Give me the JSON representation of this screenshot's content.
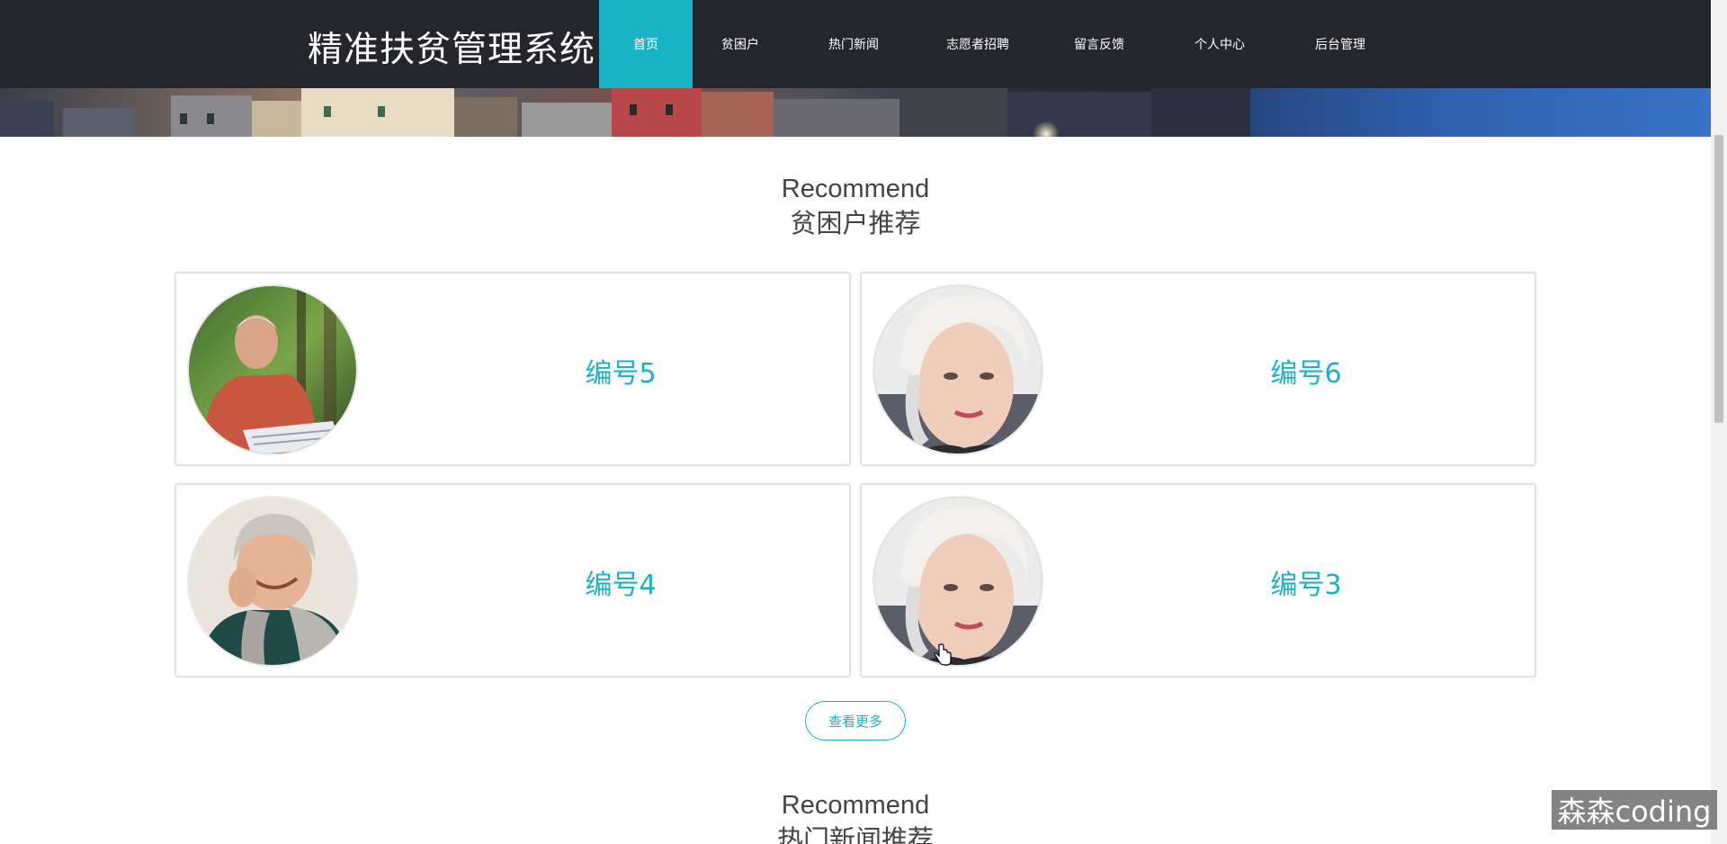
{
  "header": {
    "site_title": "精准扶贫管理系统",
    "nav": [
      {
        "label": "首页",
        "active": true
      },
      {
        "label": "贫困户"
      },
      {
        "label": "热门新闻"
      },
      {
        "label": "志愿者招聘"
      },
      {
        "label": "留言反馈"
      },
      {
        "label": "个人中心"
      },
      {
        "label": "后台管理"
      }
    ]
  },
  "section1": {
    "heading_en": "Recommend",
    "heading_cn": "贫困户推荐",
    "cards": [
      {
        "title": "编号5",
        "avatar": "elderly-man-reading-newspaper"
      },
      {
        "title": "编号6",
        "avatar": "elderly-woman-portrait"
      },
      {
        "title": "编号4",
        "avatar": "smiling-elderly-woman-scarf"
      },
      {
        "title": "编号3",
        "avatar": "elderly-woman-portrait"
      }
    ],
    "more_label": "查看更多"
  },
  "section2": {
    "heading_en": "Recommend",
    "heading_cn": "热门新闻推荐"
  },
  "watermark": "森森coding",
  "colors": {
    "accent": "#1ab3c5",
    "header_bg": "#24262c"
  }
}
